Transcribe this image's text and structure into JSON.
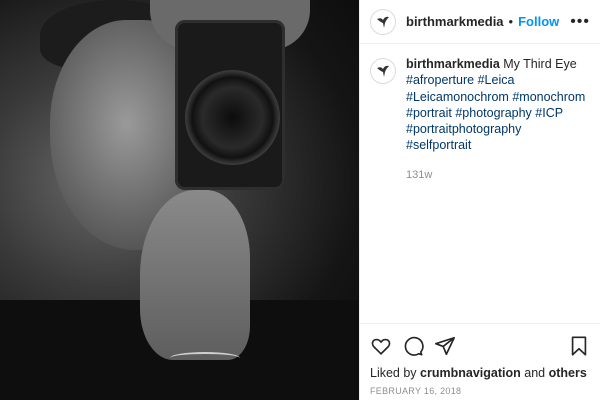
{
  "post": {
    "username": "birthmarkmedia",
    "follow_label": "Follow",
    "separator": "•",
    "more_label": "•••"
  },
  "caption": {
    "username": "birthmarkmedia",
    "text": "My Third Eye",
    "hashtags": [
      "#afroperture",
      "#Leica",
      "#Leicamonochrom",
      "#monochrom",
      "#portrait",
      "#photography",
      "#ICP",
      "#portraitphotography",
      "#selfportrait"
    ],
    "age": "131w"
  },
  "actions": {
    "icons": [
      "heart-icon",
      "comment-icon",
      "share-icon",
      "bookmark-icon"
    ]
  },
  "likes": {
    "prefix": "Liked by",
    "user": "crumbnavigation",
    "middle": "and",
    "suffix": "others"
  },
  "date": "FEBRUARY 16, 2018",
  "colors": {
    "link": "#0095f6",
    "hashtag": "#00376b",
    "muted": "#8e8e8e"
  }
}
